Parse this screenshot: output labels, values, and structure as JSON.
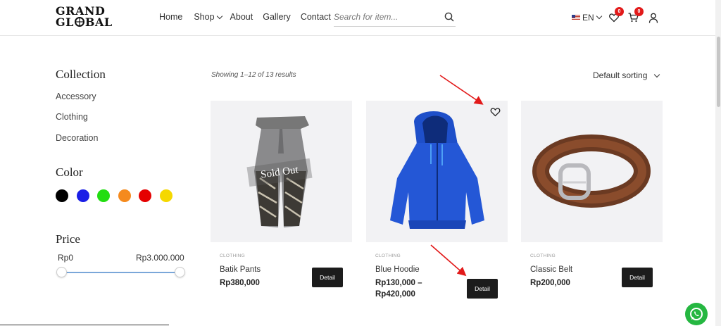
{
  "brand": {
    "line1": "GRAND",
    "line2a": "GL",
    "line2b": "BAL"
  },
  "nav": {
    "home": "Home",
    "shop": "Shop",
    "about": "About",
    "gallery": "Gallery",
    "contact": "Contact"
  },
  "search": {
    "placeholder": "Search for item..."
  },
  "header": {
    "language": "EN",
    "wishlist_count": "0",
    "cart_count": "0"
  },
  "sidebar": {
    "collection_title": "Collection",
    "collections": [
      "Accessory",
      "Clothing",
      "Decoration"
    ],
    "color_title": "Color",
    "colors": [
      "#000000",
      "#1a1ee6",
      "#22dd11",
      "#f58a1d",
      "#e50000",
      "#f5d800"
    ],
    "price_title": "Price",
    "price_min": "Rp0",
    "price_max": "Rp3.000.000"
  },
  "results": {
    "count_text": "Showing 1–12 of 13 results",
    "sorting": "Default sorting"
  },
  "products": [
    {
      "category": "CLOTHING",
      "name": "Batik Pants",
      "price": "Rp380,000",
      "price2": "",
      "badge": "Sold Out",
      "detail": "Detail"
    },
    {
      "category": "CLOTHING",
      "name": "Blue Hoodie",
      "price": "Rp130,000 –",
      "price2": "Rp420,000",
      "badge": "",
      "detail": "Detail"
    },
    {
      "category": "CLOTHING",
      "name": "Classic Belt",
      "price": "Rp200,000",
      "price2": "",
      "badge": "",
      "detail": "Detail"
    }
  ],
  "accent": "#e21a1a"
}
